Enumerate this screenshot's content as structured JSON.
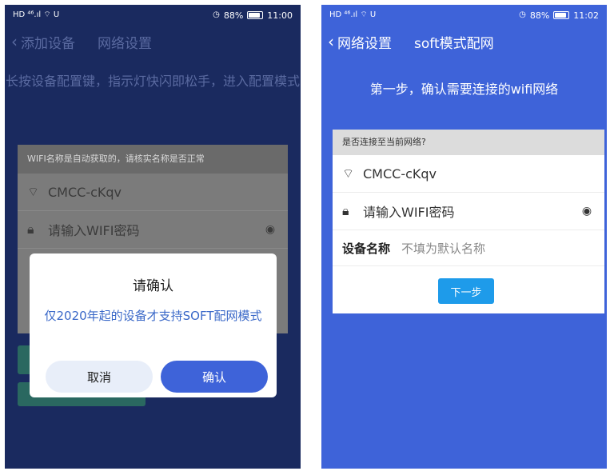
{
  "left": {
    "status": {
      "signal": "HD ⁴⁶.ıl ⌔ U",
      "battery": "88%",
      "battery_fill": 0.88,
      "time": "11:00"
    },
    "nav": {
      "back": "添加设备",
      "title": "网络设置"
    },
    "instruction": "长按设备配置键，指示灯快闪即松手，进入配置模式",
    "card": {
      "header": "WIFI名称是自动获取的，请核实名称是否正常",
      "ssid": "CMCC-cKqv",
      "password_placeholder": "请输入WIFI密码"
    },
    "dialog": {
      "title": "请确认",
      "message": "仅2020年起的设备才支持SOFT配网模式",
      "cancel": "取消",
      "confirm": "确认"
    }
  },
  "right": {
    "status": {
      "signal": "HD ⁴⁶.ıl ⌔ U",
      "battery": "88%",
      "battery_fill": 0.88,
      "time": "11:02"
    },
    "nav": {
      "back": "网络设置",
      "title": "soft模式配网"
    },
    "step_title": "第一步，确认需要连接的wifi网络",
    "card": {
      "header": "是否连接至当前网络?",
      "ssid": "CMCC-cKqv",
      "password_placeholder": "请输入WIFI密码",
      "device_label": "设备名称",
      "device_placeholder": "不填为默认名称",
      "next": "下一步"
    }
  },
  "colors": {
    "accent": "#3e63d9",
    "dark_bg": "#1a2a5f",
    "next_button": "#1e9bea"
  }
}
